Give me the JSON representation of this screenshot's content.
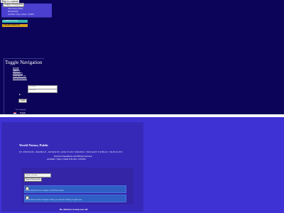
{
  "skip_link": "Skip to content",
  "header": {
    "toggle_label": "Toggle Navigation",
    "contact_lines": [
      "World Notary Public",
      "800-000-0000",
      "Available 7 Days a Week · 6:30PM"
    ],
    "buttons": {
      "primary": "SCHEDULE NOW",
      "secondary": "NOTARY SERVICES"
    }
  },
  "sidebar": {
    "heading": "Toggle Navigation",
    "menu": [
      "HOME",
      "ABOUT",
      "SERVICES",
      "CONTACT US",
      "MY ACCOUNT"
    ],
    "login": {
      "username_placeholder": "Username",
      "password_placeholder": "Password",
      "button_label": "Login"
    },
    "language": {
      "label": "English",
      "sub": "Select language"
    }
  },
  "hero": {
    "title": "World Notary Public",
    "subtitle": "IN PERSON, MOBILE, REMOTE AND ELECTRONIC NOTARY PUBLIC SERVICES",
    "line1": "Practical, Expeditious and Efficient Services",
    "line2": "Available 7 Days a Week 6:30 AM - 6:30 PM",
    "select_value": "Choose a Service",
    "button_label": "Request Notary Quote",
    "info1": "Please click the icon to expand. To find the location",
    "info2": "Please find us when we begin to notify you onscreen. Thank you again soon.",
    "footer": "Hi, click here to book your call"
  },
  "colors": {
    "top_band": "#0c0458",
    "bottom_band": "#3f32d5",
    "accent_teal": "#38b9b1",
    "accent_yellow": "#d9a21c"
  }
}
